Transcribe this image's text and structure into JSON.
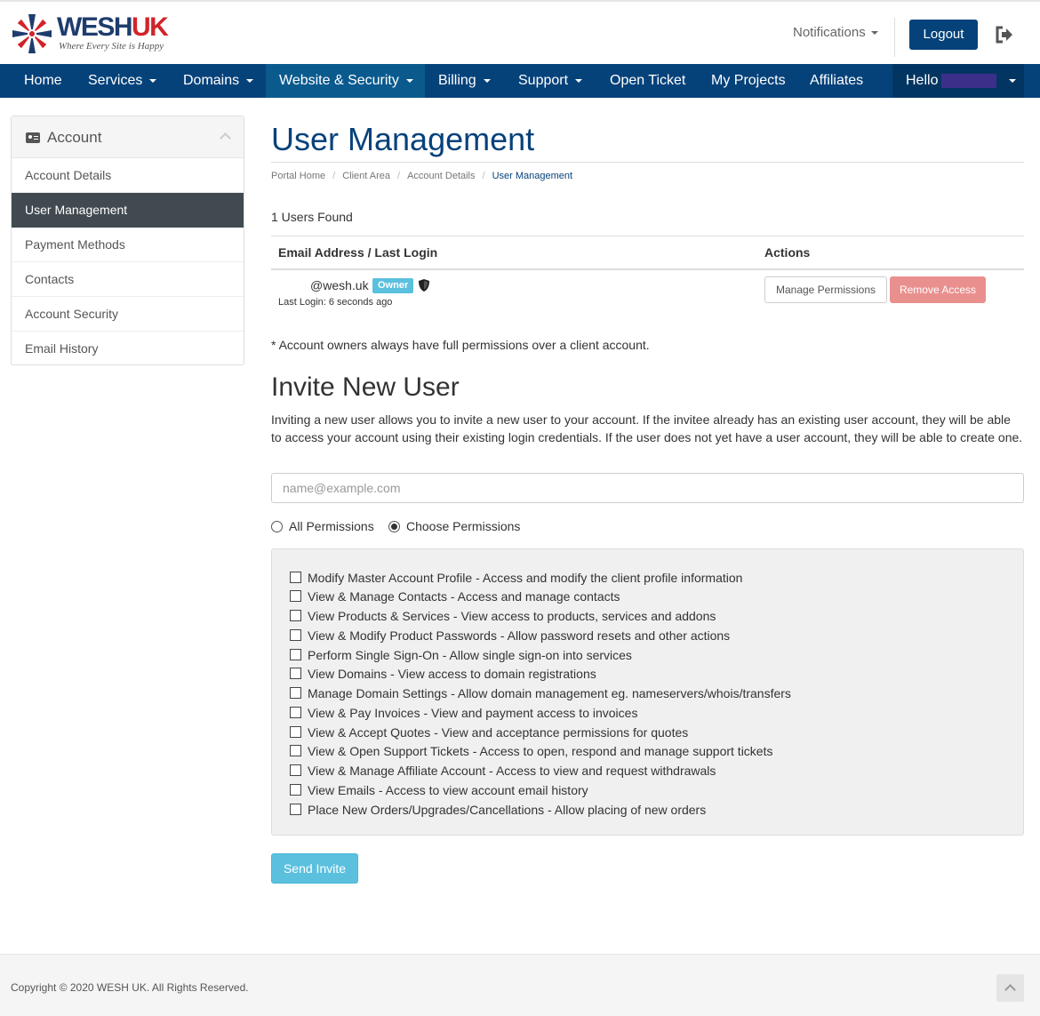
{
  "brand": {
    "logo_main": "WESH",
    "logo_accent": "UK",
    "tagline": "Where Every Site is Happy"
  },
  "header": {
    "notifications_label": "Notifications",
    "logout_label": "Logout",
    "exit_icon": "sign-out-icon"
  },
  "nav": {
    "items": [
      {
        "label": "Home",
        "dropdown": false
      },
      {
        "label": "Services",
        "dropdown": true
      },
      {
        "label": "Domains",
        "dropdown": true
      },
      {
        "label": "Website & Security",
        "dropdown": true,
        "active": true
      },
      {
        "label": "Billing",
        "dropdown": true
      },
      {
        "label": "Support",
        "dropdown": true
      },
      {
        "label": "Open Ticket",
        "dropdown": false
      },
      {
        "label": "My Projects",
        "dropdown": false
      },
      {
        "label": "Affiliates",
        "dropdown": false
      }
    ],
    "hello_label": "Hello"
  },
  "sidebar": {
    "title": "Account",
    "items": [
      {
        "label": "Account Details"
      },
      {
        "label": "User Management",
        "active": true
      },
      {
        "label": "Payment Methods"
      },
      {
        "label": "Contacts"
      },
      {
        "label": "Account Security"
      },
      {
        "label": "Email History"
      }
    ]
  },
  "page": {
    "title": "User Management",
    "breadcrumb": [
      "Portal Home",
      "Client Area",
      "Account Details",
      "User Management"
    ]
  },
  "users": {
    "count_text": "1 Users Found",
    "col_email": "Email Address / Last Login",
    "col_actions": "Actions",
    "rows": [
      {
        "email": "@wesh.uk",
        "badge": "Owner",
        "last_login": "Last Login: 6 seconds ago",
        "manage_label": "Manage Permissions",
        "remove_label": "Remove Access"
      }
    ],
    "owner_note": "* Account owners always have full permissions over a client account."
  },
  "invite": {
    "title": "Invite New User",
    "description": "Inviting a new user allows you to invite a new user to your account. If the invitee already has an existing user account, they will be able to access your account using their existing login credentials. If the user does not yet have a user account, they will be able to create one.",
    "email_placeholder": "name@example.com",
    "email_value": "",
    "radio_all": "All Permissions",
    "radio_choose": "Choose Permissions",
    "selected": "choose",
    "permissions": [
      "Modify Master Account Profile - Access and modify the client profile information",
      "View & Manage Contacts - Access and manage contacts",
      "View Products & Services - View access to products, services and addons",
      "View & Modify Product Passwords - Allow password resets and other actions",
      "Perform Single Sign-On - Allow single sign-on into services",
      "View Domains - View access to domain registrations",
      "Manage Domain Settings - Allow domain management eg. nameservers/whois/transfers",
      "View & Pay Invoices - View and payment access to invoices",
      "View & Accept Quotes - View and acceptance permissions for quotes",
      "View & Open Support Tickets - Access to open, respond and manage support tickets",
      "View & Manage Affiliate Account - Access to view and request withdrawals",
      "View Emails - Access to view account email history",
      "Place New Orders/Upgrades/Cancellations - Allow placing of new orders"
    ],
    "send_label": "Send Invite"
  },
  "footer": {
    "copyright": "Copyright © 2020 WESH UK. All Rights Reserved."
  },
  "colors": {
    "brand_blue": "#06427a",
    "info": "#5bc0de",
    "danger_light": "#e9908e",
    "sidebar_active": "#414a51"
  }
}
